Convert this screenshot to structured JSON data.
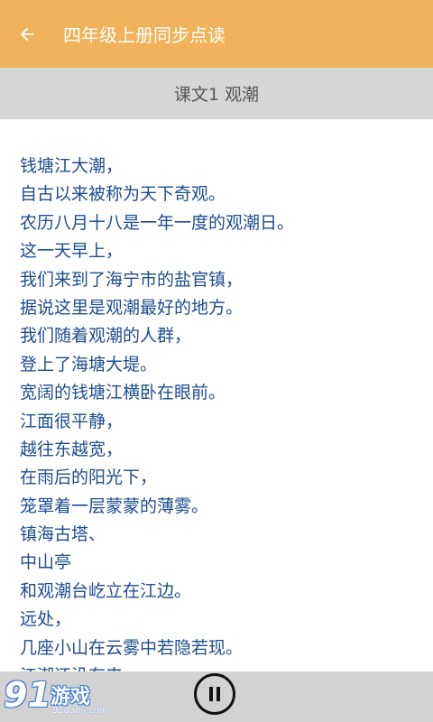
{
  "appbar": {
    "title": "四年级上册同步点读",
    "back_icon": "arrow-left-icon"
  },
  "lesson": {
    "title": "课文1 观潮"
  },
  "text_lines": [
    "钱塘江大潮，",
    "自古以来被称为天下奇观。",
    "农历八月十八是一年一度的观潮日。",
    "这一天早上，",
    "我们来到了海宁市的盐官镇，",
    "据说这里是观潮最好的地方。",
    "我们随着观潮的人群，",
    "登上了海塘大堤。",
    "宽阔的钱塘江横卧在眼前。",
    "江面很平静，",
    "越往东越宽，",
    "在雨后的阳光下，",
    "笼罩着一层蒙蒙的薄雾。",
    "镇海古塔、",
    "中山亭",
    "和观潮台屹立在江边。",
    "远处，",
    "几座小山在云雾中若隐若现。",
    "江潮还没有来"
  ],
  "player": {
    "pause_icon": "pause-icon"
  },
  "watermark": {
    "number": "91",
    "name": "游戏",
    "site": "91danji.com"
  },
  "colors": {
    "appbar": "#f0b25a",
    "lesson_bar": "#d6d6d6",
    "text": "#1e4d8f",
    "player_bar": "#d2d2d2"
  }
}
